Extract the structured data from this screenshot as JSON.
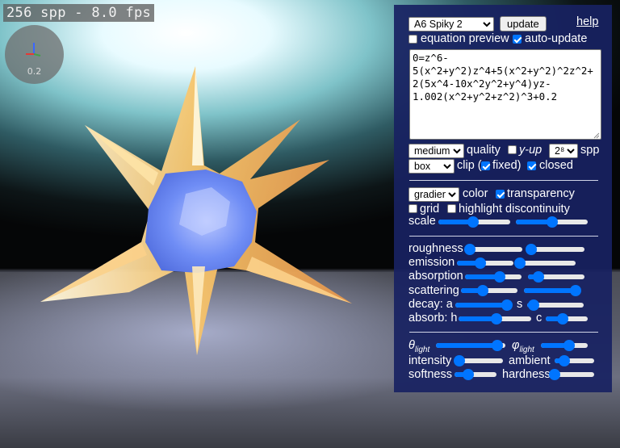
{
  "viewport": {
    "status_text": "256 spp - 8.0 fps",
    "axes_gizmo_value": "0.2"
  },
  "panel": {
    "preset_select": "A6 Spiky 2",
    "update_button": "update",
    "help_link": "help",
    "equation_preview": {
      "label": "equation preview",
      "checked": false
    },
    "auto_update": {
      "label": "auto-update",
      "checked": true
    },
    "equation": "0=z^6-5(x^2+y^2)z^4+5(x^2+y^2)^2z^2+2(5x^4-10x^2y^2+y^4)yz-1.002(x^2+y^2+z^2)^3+0.2",
    "quality_select": "medium",
    "quality_label": "quality",
    "y_up": {
      "label": "y-up",
      "checked": false
    },
    "spp_select": "2⁸",
    "spp_label": "spp",
    "clip_select": "box",
    "clip_label": "clip (",
    "fixed": {
      "label": "fixed)",
      "checked": true
    },
    "closed": {
      "label": "closed",
      "checked": true
    },
    "color_select": "gradient",
    "color_label": "color",
    "transparency": {
      "label": "transparency",
      "checked": true
    },
    "grid": {
      "label": "grid",
      "checked": false
    },
    "highlight_discontinuity": {
      "label": "highlight discontinuity",
      "checked": false
    },
    "scale_label": "scale",
    "scale_values": [
      0.48,
      0.5
    ],
    "material": {
      "roughness_label": "roughness",
      "roughness_values": [
        0.02,
        0.05
      ],
      "emission_label": "emission",
      "emission_values": [
        0.42,
        0.02
      ],
      "absorption_label": "absorption",
      "absorption_values": [
        0.62,
        0.18
      ],
      "scattering_label": "scattering",
      "scattering_values": [
        0.38,
        0.92
      ],
      "decay_a_label": "decay: a",
      "decay_a_value": 0.92,
      "decay_s_label": "s",
      "decay_s_value": 0.12,
      "absorb_h_label": "absorb: h",
      "absorb_h_value": 0.52,
      "absorb_c_label": "c",
      "absorb_c_value": 0.4
    },
    "light": {
      "theta_label": "θ",
      "theta_sub": "light",
      "theta_value": 0.88,
      "phi_label": "φ",
      "phi_sub": "light",
      "phi_value": 0.6,
      "intensity_label": "intensity",
      "intensity_value": 0.1,
      "ambient_label": "ambient",
      "ambient_value": 0.25,
      "softness_label": "softness",
      "softness_value": 0.32,
      "hardness_label": "hardness",
      "hardness_value": 0.05
    }
  },
  "colors": {
    "panel_bg": "#182262",
    "accent": "#0075ff",
    "surface_blue": "#6f8df5",
    "spike_gold": "#f7c46a"
  }
}
